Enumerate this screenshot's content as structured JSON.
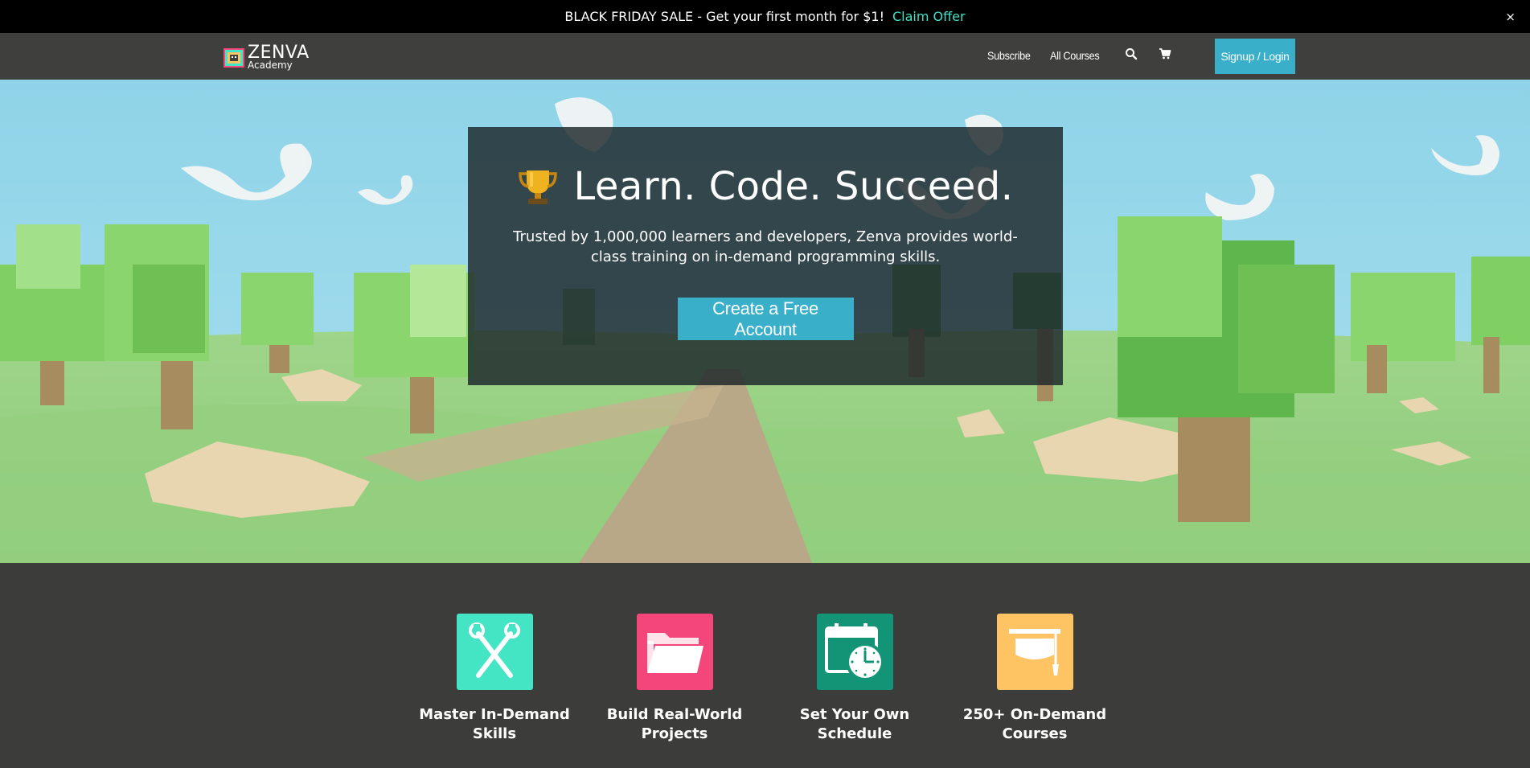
{
  "promo": {
    "text": "BLACK FRIDAY SALE - Get your first month for $1!",
    "cta": "Claim Offer",
    "close": "×"
  },
  "nav": {
    "logo_word": "ZENVA",
    "logo_sub": "Academy",
    "links": [
      "Subscribe",
      "All Courses"
    ],
    "icons": [
      "search-icon",
      "cart-icon"
    ],
    "signup": "Signup / Login"
  },
  "hero": {
    "title": "Learn. Code. Succeed.",
    "subtitle": "Trusted by 1,000,000 learners and developers, Zenva provides world-class training on in-demand programming skills.",
    "button": "Create a Free Account"
  },
  "features": [
    {
      "label": "Master In-Demand Skills",
      "icon": "wrench-icon",
      "color": "#44e5c4"
    },
    {
      "label": "Build Real-World Projects",
      "icon": "folder-icon",
      "color": "#f4467a"
    },
    {
      "label": "Set Your Own Schedule",
      "icon": "calendar-clock-icon",
      "color": "#149476"
    },
    {
      "label": "250+ On-Demand Courses",
      "icon": "graduation-cap-icon",
      "color": "#fec464"
    }
  ],
  "colors": {
    "accent": "#3aafc9",
    "promo_link": "#3fe0c5",
    "dark_bg": "#3c3c3b"
  }
}
